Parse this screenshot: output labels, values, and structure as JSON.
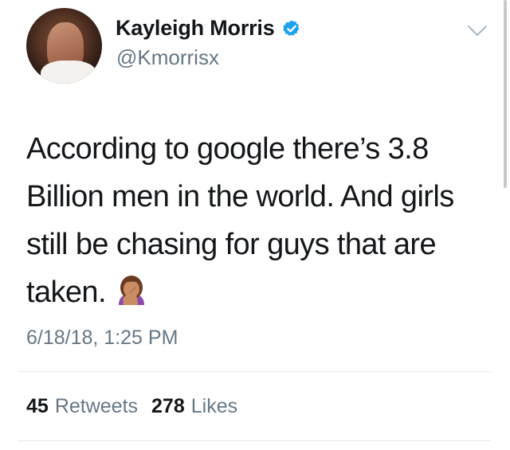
{
  "tweet": {
    "display_name": "Kayleigh Morris",
    "handle": "@Kmorrisx",
    "verified_icon": "verified-badge-icon",
    "text": "According to google there’s 3.8 Billion men in the world. And girls still be chasing for guys that are taken.",
    "emoji": "woman-facepalming-emoji",
    "timestamp": "6/18/18, 1:25 PM",
    "retweets_count": "45",
    "retweets_label": "Retweets",
    "likes_count": "278",
    "likes_label": "Likes"
  },
  "colors": {
    "text_primary": "#14171a",
    "text_secondary": "#657786",
    "verified_blue": "#1da1f2",
    "divider": "#e1e8ed"
  }
}
